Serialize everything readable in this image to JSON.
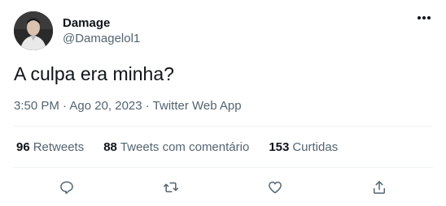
{
  "tweet": {
    "author": {
      "name": "Damage",
      "handle": "@Damagelol1",
      "avatar_icon": "user-avatar-photo"
    },
    "text": "A culpa era minha?",
    "meta": "3:50 PM · Ago 20, 2023 · Twitter Web App",
    "stats": [
      {
        "count": "96",
        "label": "Retweets"
      },
      {
        "count": "88",
        "label": "Tweets com comentário"
      },
      {
        "count": "153",
        "label": "Curtidas"
      }
    ],
    "actions": [
      "reply-icon",
      "retweet-icon",
      "like-icon",
      "share-icon"
    ],
    "more_icon": "more-options-icon"
  },
  "colors": {
    "primary_text": "#0f1419",
    "secondary_text": "#536471",
    "divider": "#eff3f4"
  }
}
